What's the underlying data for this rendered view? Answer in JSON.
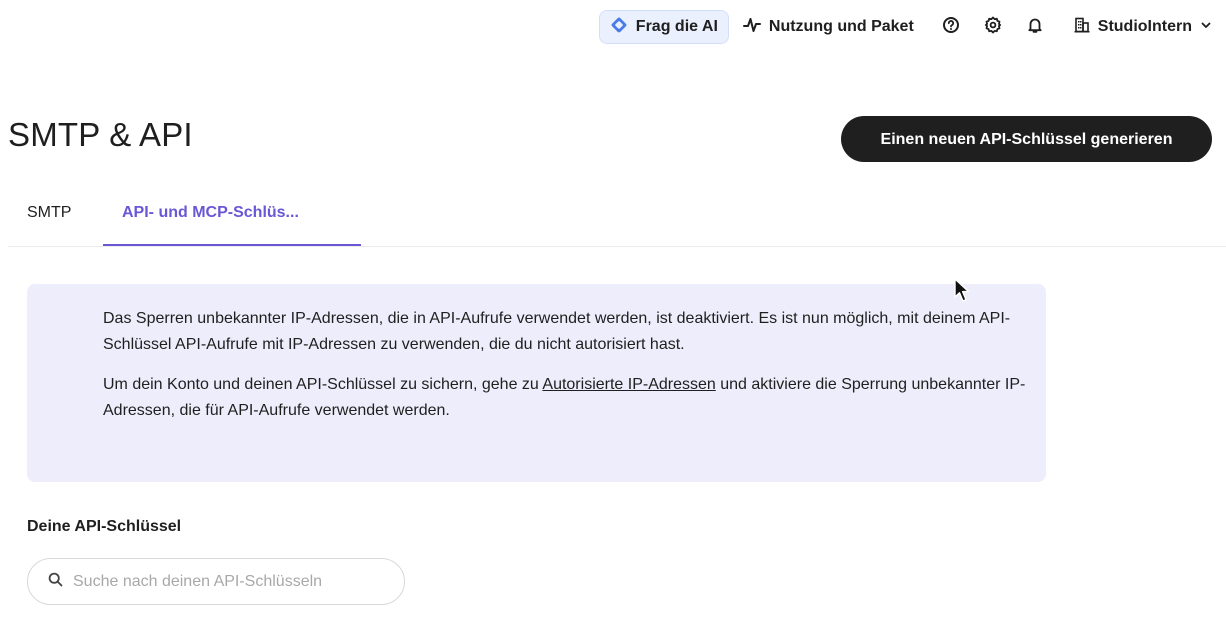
{
  "topbar": {
    "ai_label": "Frag die AI",
    "usage_label": "Nutzung und Paket",
    "account_label": "StudioIntern",
    "icons": [
      "help-icon",
      "settings-icon",
      "bell-icon"
    ]
  },
  "page": {
    "title": "SMTP & API",
    "primary_button": "Einen neuen API-Schlüssel generieren"
  },
  "tabs": [
    {
      "label": "SMTP",
      "active": false
    },
    {
      "label": "API- und MCP-Schlüs...",
      "active": true
    }
  ],
  "info": {
    "paragraph1": "Das Sperren unbekannter IP-Adressen, die in API-Aufrufe verwendet werden, ist deaktiviert. Es ist nun möglich, mit deinem API-Schlüssel API-Aufrufe mit IP-Adressen zu verwenden, die du nicht autorisiert hast.",
    "paragraph2_before": "Um dein Konto und deinen API-Schlüssel zu sichern, gehe zu ",
    "paragraph2_link": "Autorisierte IP-Adressen",
    "paragraph2_after": " und aktiviere die Sperrung unbekannter IP-Adressen, die für API-Aufrufe verwendet werden."
  },
  "keys_section": {
    "title": "Deine API-Schlüssel",
    "search_placeholder": "Suche nach deinen API-Schlüsseln",
    "search_value": ""
  },
  "colors": {
    "accent": "#6a57d6",
    "info_bg": "#eeedfb",
    "primary_button_bg": "#1f1f1f",
    "ai_button_bg": "#eaf0fd"
  }
}
